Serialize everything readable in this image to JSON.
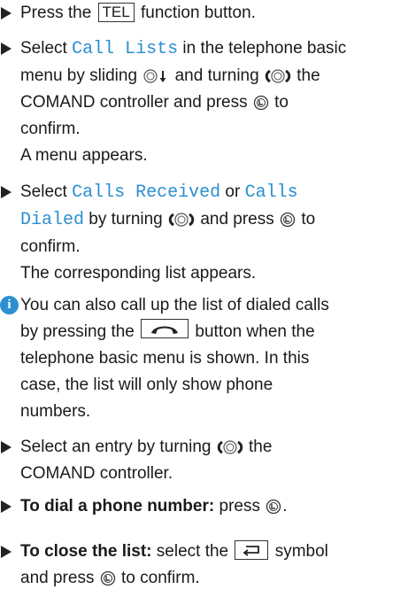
{
  "steps": [
    {
      "pre": "Press the",
      "key": "TEL",
      "post": "function button."
    },
    {
      "select": "Select",
      "item": "Call Lists",
      "t1": "in the telephone basic",
      "t2": "menu by sliding",
      "t3": "and turning",
      "t4": "the",
      "t5": "COMAND controller and press",
      "t6": "to",
      "t7": "confirm.",
      "result": "A menu appears."
    },
    {
      "select": "Select",
      "item1": "Calls Received",
      "or": "or",
      "item2a": "Calls",
      "item2b": "Dialed",
      "t1": "by turning",
      "t2": "and press",
      "t3": "to",
      "t4": "confirm.",
      "result": "The corresponding list appears."
    }
  ],
  "note": {
    "icon": "i",
    "l1": "You can also call up the list of dialed calls",
    "l2a": "by pressing the",
    "l2b": "button when the",
    "l3": "telephone basic menu is shown. In this",
    "l4": "case, the list will only show phone",
    "l5": "numbers."
  },
  "steps2": [
    {
      "l1a": "Select an entry by turning",
      "l1b": "the",
      "l2": "COMAND controller."
    },
    {
      "bold": "To dial a phone number:",
      "rest": "press"
    },
    {
      "bold": "To close the list:",
      "rest1": "select the",
      "rest2": "symbol",
      "l2a": "and press",
      "l2b": "to confirm."
    }
  ],
  "icons": {
    "bullet": "triangle-bullet-icon",
    "press": "controller-press-icon",
    "turn": "controller-turn-icon",
    "slide": "controller-slide-down-icon",
    "phone": "phone-handset-icon",
    "back": "back-arrow-icon",
    "info": "info-icon"
  },
  "colors": {
    "accent": "#2b8fd0",
    "text": "#1a1a1a"
  }
}
